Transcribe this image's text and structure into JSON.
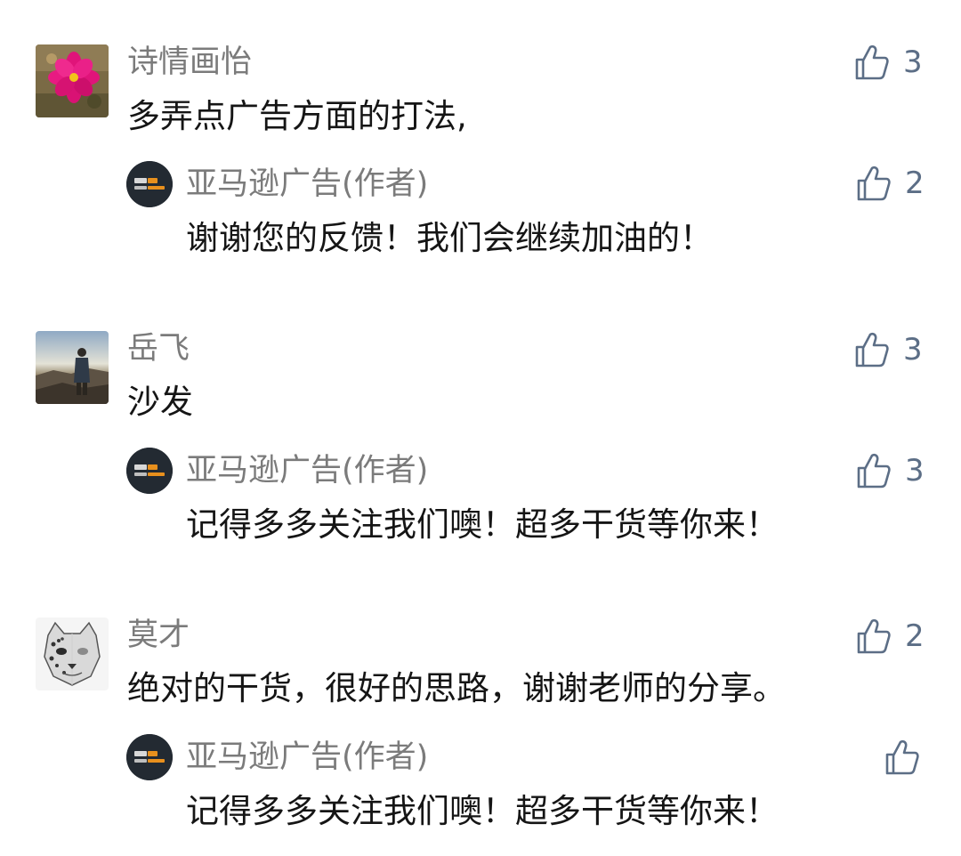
{
  "comments": [
    {
      "name": "诗情画怡",
      "avatar_icon": "pink-flower-avatar",
      "text": "多弄点广告方面的打法,",
      "likes": "3",
      "reply": {
        "name": "亚马逊广告(作者)",
        "avatar_icon": "amazon-advertising-logo",
        "text": "谢谢您的反馈！我们会继续加油的！",
        "likes": "2"
      }
    },
    {
      "name": "岳飞",
      "avatar_icon": "landscape-person-avatar",
      "text": "沙发",
      "likes": "3",
      "reply": {
        "name": "亚马逊广告(作者)",
        "avatar_icon": "amazon-advertising-logo",
        "text": "记得多多关注我们噢！超多干货等你来！",
        "likes": "3"
      }
    },
    {
      "name": "莫才",
      "avatar_icon": "leopard-sketch-avatar",
      "text": "绝对的干货，很好的思路，谢谢老师的分享。",
      "likes": "2",
      "reply": {
        "name": "亚马逊广告(作者)",
        "avatar_icon": "amazon-advertising-logo",
        "text": "记得多多关注我们噢！超多干货等你来！",
        "likes": ""
      }
    }
  ],
  "colors": {
    "name_gray": "#7b7b7b",
    "like_blue": "#5c6e86",
    "text": "#151515"
  }
}
